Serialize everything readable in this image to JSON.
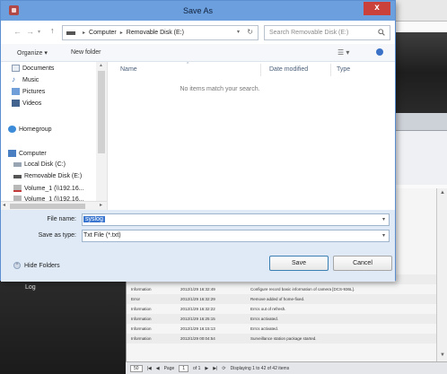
{
  "dialog": {
    "title": "Save As",
    "close_label": "x",
    "address": {
      "root": "Computer",
      "location": "Removable Disk (E:)"
    },
    "search_placeholder": "Search Removable Disk (E:)",
    "toolbar": {
      "organize": "Organize ▾",
      "new_folder": "New folder",
      "view_label": "☰ ▾"
    },
    "nav": {
      "items": [
        "Documents",
        "Music",
        "Pictures",
        "Videos",
        "Homegroup",
        "Computer",
        "Local Disk (C:)",
        "Removable Disk (E:)",
        "Volume_1 (\\\\192.16...",
        "Volume_1 (\\\\192.16..."
      ]
    },
    "columns": {
      "name": "Name",
      "date_modified": "Date modified",
      "type": "Type"
    },
    "empty_message": "No items match your search.",
    "form": {
      "file_name_label": "File name:",
      "file_name_value": "syslog",
      "save_type_label": "Save as type:",
      "save_type_value": "Txt File (*.txt)"
    },
    "hide_folders": "Hide Folders",
    "save_button": "Save",
    "cancel_button": "Cancel"
  },
  "background": {
    "sidebar_label": "Log",
    "log_rows": [
      {
        "level": "Information",
        "time": "2012/1/29 16:32:49",
        "message": "Configure schedule of camera [DCS-936L]."
      },
      {
        "level": "Information",
        "time": "2012/1/29 16:32:49",
        "message": "Configure record basic information of camera [DCS-936L]."
      },
      {
        "level": "Error",
        "time": "2012/1/29 16:32:29",
        "message": "Remove added of home-fixed."
      },
      {
        "level": "Information",
        "time": "2012/1/29 16:32:22",
        "message": "Errcs out of refresh."
      },
      {
        "level": "Information",
        "time": "2012/1/29 16:25:15",
        "message": "Errcs activated."
      },
      {
        "level": "Information",
        "time": "2012/1/29 16:15:13",
        "message": "Errcs activated."
      },
      {
        "level": "Information",
        "time": "2012/1/29 00:04:54",
        "message": "Surveillance station package started."
      }
    ],
    "pager": {
      "per_page": "50",
      "page_label": "Page",
      "page_value": "1",
      "of_label": "of 1",
      "status": "Displaying 1 to 42 of 42 items"
    }
  },
  "colors": {
    "titlebar": "#6b9fde",
    "close": "#c9413a",
    "selection": "#3a76d0"
  }
}
